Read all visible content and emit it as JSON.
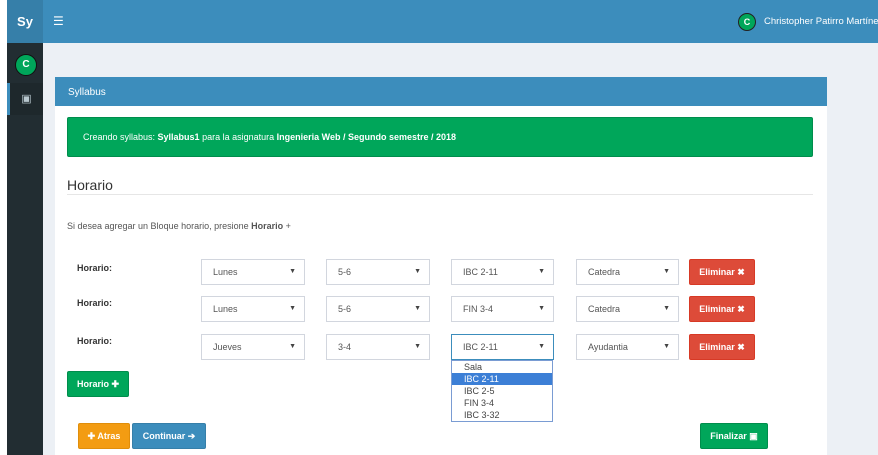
{
  "topbar": {
    "brand": "Sy",
    "menu_icon": "hamburger-icon",
    "user_initial": "C",
    "user_name": "Christopher Patirro Martínez"
  },
  "sidebar": {
    "avatar_initial": "C",
    "items": [
      {
        "icon": "calendar-icon",
        "glyph": "▣"
      }
    ]
  },
  "box": {
    "title": "Syllabus",
    "alert": {
      "prefix": "Creando syllabus: ",
      "syllabus": "Syllabus1",
      "middle": " para la asignatura ",
      "course": "Ingenieria Web / Segundo semestre / 2018"
    },
    "section_title": "Horario",
    "hint_prefix": "Si desea agregar un Bloque horario, presione ",
    "hint_strong": "Horario",
    "hint_suffix": " +"
  },
  "rows": [
    {
      "label": "Horario:",
      "day": "Lunes",
      "block": "5-6",
      "room": "IBC 2-11",
      "type": "Catedra",
      "delete_label": "Eliminar ✖"
    },
    {
      "label": "Horario:",
      "day": "Lunes",
      "block": "5-6",
      "room": "FIN 3-4",
      "type": "Catedra",
      "delete_label": "Eliminar ✖"
    },
    {
      "label": "Horario:",
      "day": "Jueves",
      "block": "3-4",
      "room": "IBC 2-11",
      "type": "Ayudantia",
      "delete_label": "Eliminar ✖"
    }
  ],
  "room_options": [
    "Sala",
    "IBC 2-11",
    "IBC 2-5",
    "FIN 3-4",
    "IBC 3-32"
  ],
  "room_options_highlighted": "IBC 2-11",
  "buttons": {
    "add_horario": "Horario ✚",
    "back": "✚ Atras",
    "continue": "Continuar ➔",
    "finish": "Finalizar ▣"
  },
  "colors": {
    "primary": "#3c8dbc",
    "success": "#00a65a",
    "danger": "#dd4b39",
    "warning": "#f39c12",
    "sidebar": "#222d32"
  }
}
